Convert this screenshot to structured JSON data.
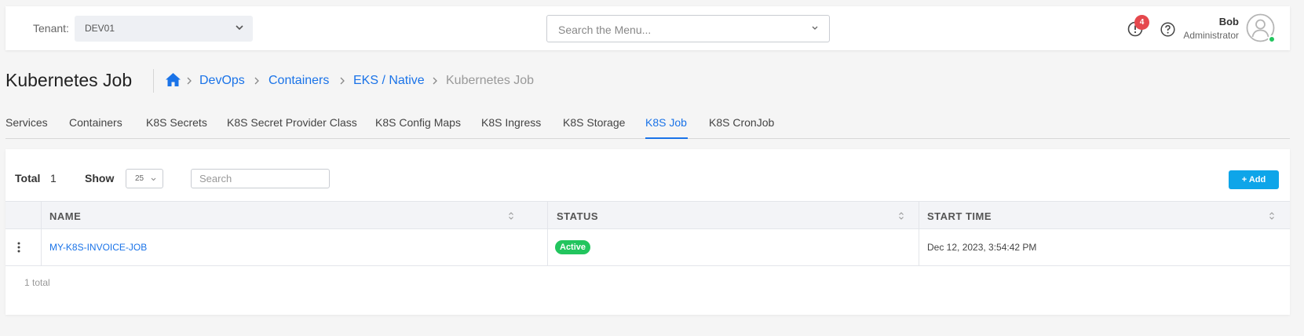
{
  "header": {
    "tenant_label": "Tenant:",
    "tenant_value": "DEV01",
    "menu_search_placeholder": "Search the Menu...",
    "alert_count": "4",
    "user_name": "Bob",
    "user_role": "Administrator"
  },
  "page": {
    "title": "Kubernetes Job",
    "breadcrumb": [
      "DevOps",
      "Containers",
      "EKS / Native",
      "Kubernetes Job"
    ]
  },
  "tabs": [
    {
      "label": "Services"
    },
    {
      "label": "Containers"
    },
    {
      "label": "K8S Secrets"
    },
    {
      "label": "K8S Secret Provider Class"
    },
    {
      "label": "K8S Config Maps"
    },
    {
      "label": "K8S Ingress"
    },
    {
      "label": "K8S Storage"
    },
    {
      "label": "K8S Job"
    },
    {
      "label": "K8S CronJob"
    }
  ],
  "active_tab": "K8S Job",
  "toolbar": {
    "total_label": "Total",
    "total_value": "1",
    "show_label": "Show",
    "show_value": "25",
    "search_placeholder": "Search",
    "add_label": "+ Add"
  },
  "table": {
    "columns": [
      "NAME",
      "STATUS",
      "START TIME"
    ],
    "rows": [
      {
        "name": "MY-K8S-INVOICE-JOB",
        "status": "Active",
        "start_time": "Dec 12, 2023, 3:54:42 PM"
      }
    ],
    "footer": "1 total"
  },
  "colors": {
    "accent": "#1a73e8",
    "add_button": "#0ea5e9",
    "status_active": "#22c55e",
    "alert_badge": "#e5484d"
  }
}
